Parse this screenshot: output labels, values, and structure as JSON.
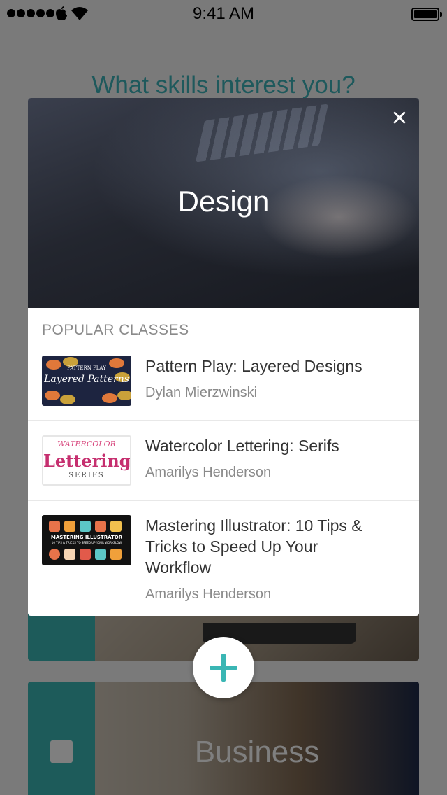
{
  "status_bar": {
    "time": "9:41 AM",
    "icons": [
      "signal-dots-icon",
      "apple-icon",
      "wifi-icon",
      "battery-icon"
    ]
  },
  "background": {
    "heading": "What skills interest you?",
    "business_card_label": "Business",
    "accent_color": "#3ab6b4"
  },
  "modal": {
    "hero_title": "Design",
    "close_label": "✕",
    "section_header": "POPULAR CLASSES",
    "classes": [
      {
        "title_lines": [
          "Pattern Play: Layered Designs"
        ],
        "author": "Dylan Mierzwinski",
        "thumb": {
          "line1": "PATTERN PLAY",
          "line2": "Layered Patterns"
        }
      },
      {
        "title_lines": [
          "Watercolor Lettering: Serifs"
        ],
        "author": "Amarilys Henderson",
        "thumb": {
          "line1": "WATERCOLOR",
          "line2": "Lettering",
          "line3": "SERIFS"
        }
      },
      {
        "title_lines": [
          "Mastering Illustrator: 10 Tips &",
          "Tricks to Speed Up Your",
          "Workflow"
        ],
        "author": "Amarilys Henderson",
        "thumb": {
          "line1": "MASTERING ILLUSTRATOR",
          "line2": "10 TIPS & TRICKS TO SPEED UP YOUR WORKFLOW"
        }
      }
    ]
  },
  "add_button": {
    "icon": "plus-icon"
  }
}
